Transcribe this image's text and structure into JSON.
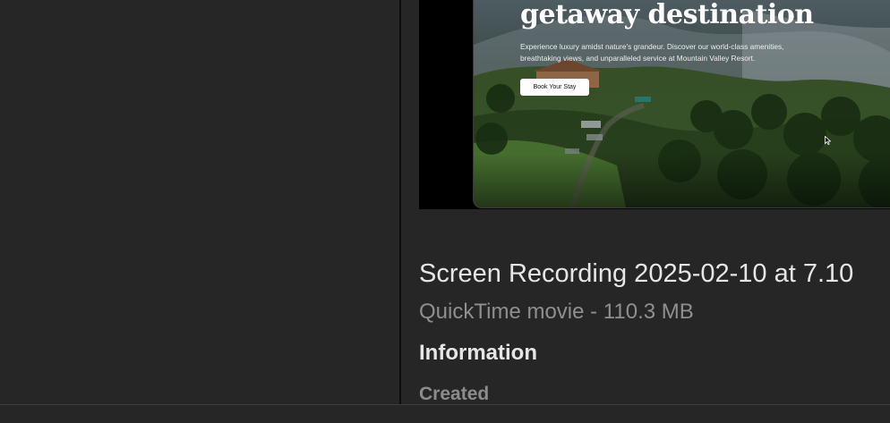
{
  "preview": {
    "hero_heading": "getaway destination",
    "hero_body": "Experience luxury amidst nature's grandeur. Discover our world-class amenities, breathtaking views, and unparalleled service at Mountain Valley Resort.",
    "hero_button_label": "Book Your Stay",
    "cursor_icon": "mouse-pointer-icon"
  },
  "file": {
    "title": "Screen Recording 2025-02-10 at 7.10",
    "subtitle": "QuickTime movie - 110.3 MB"
  },
  "information": {
    "heading": "Information",
    "created_label": "Created"
  },
  "colors": {
    "background": "#262626",
    "divider": "#0d0d0d",
    "title_text": "#e6e6e6",
    "secondary_text": "#8f8f8f"
  }
}
